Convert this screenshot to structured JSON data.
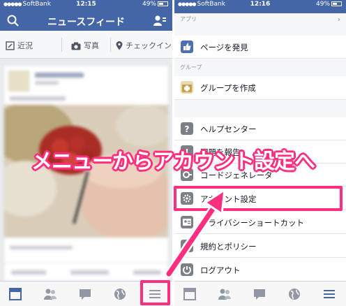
{
  "left": {
    "status": {
      "carrier": "SoftBank",
      "time": "12:15",
      "battery": "49%"
    },
    "header": {
      "title": "ニュースフィード",
      "search_icon": "search-icon",
      "friends_icon": "friend-requests-icon"
    },
    "actions": [
      {
        "label": "近況",
        "icon": "compose-icon"
      },
      {
        "label": "写真",
        "icon": "camera-icon"
      },
      {
        "label": "チェックイン",
        "icon": "location-icon"
      }
    ],
    "tabs": [
      "news-feed-icon",
      "friends-icon",
      "messages-icon",
      "globe-icon",
      "menu-icon"
    ]
  },
  "right": {
    "status": {
      "carrier": "SoftBank",
      "time": "12:16",
      "battery": "49%"
    },
    "sections": {
      "apps": "アプリ",
      "groups": "グループ"
    },
    "menu": [
      {
        "label": "ページを発見",
        "icon": "pages-icon",
        "color": "#4f6fb3"
      },
      {
        "label": "グループを作成",
        "icon": "create-group-icon",
        "color": "#c9a04a"
      },
      {
        "label": "ヘルプセンター",
        "icon": "help-icon",
        "color": "#7a8086"
      },
      {
        "label": "問題を報告",
        "icon": "report-icon",
        "color": "#7a8086"
      },
      {
        "label": "コードジェネレータ",
        "icon": "code-generator-icon",
        "color": "#7a8086"
      },
      {
        "label": "アカウント設定",
        "icon": "settings-gear-icon",
        "color": "#7a8086"
      },
      {
        "label": "プライバシーショートカット",
        "icon": "privacy-icon",
        "color": "#7a8086"
      },
      {
        "label": "規約とポリシー",
        "icon": "terms-icon",
        "color": "#7a8086"
      },
      {
        "label": "ログアウト",
        "icon": "logout-icon",
        "color": "#7a8086"
      }
    ],
    "tabs": [
      "news-feed-icon",
      "friends-icon",
      "messages-icon",
      "globe-icon",
      "menu-icon"
    ]
  },
  "overlay": {
    "caption": "メニューからアカウント設定へ"
  },
  "colors": {
    "facebook_blue": "#4566a6",
    "highlight_pink": "#ff2e7e"
  }
}
